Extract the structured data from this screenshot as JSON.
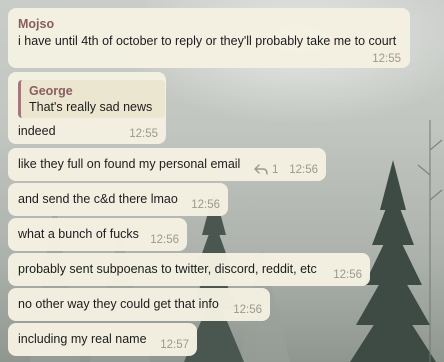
{
  "messages": [
    {
      "sender": "Mojso",
      "text": "i have until 4th of october to reply or they'll probably take me to court",
      "time": "12:55"
    },
    {
      "quote": {
        "name": "George",
        "text": "That's really sad news"
      },
      "text": "indeed",
      "time": "12:55"
    },
    {
      "text": "like they full on found my personal email",
      "replies": "1",
      "time": "12:56"
    },
    {
      "text": "and send the c&d there lmao",
      "time": "12:56"
    },
    {
      "text": "what a bunch of fucks",
      "time": "12:56"
    },
    {
      "text": "probably sent subpoenas to twitter, discord, reddit, etc",
      "time": "12:56"
    },
    {
      "text": "no other way they could get that info",
      "time": "12:56"
    },
    {
      "text": "including my real name",
      "time": "12:57"
    }
  ],
  "icons": {
    "reply": "reply-arrow-icon"
  },
  "colors": {
    "bubble": "#f4f1e2",
    "sender": "#8b5d60",
    "time": "#9a9a8c"
  }
}
